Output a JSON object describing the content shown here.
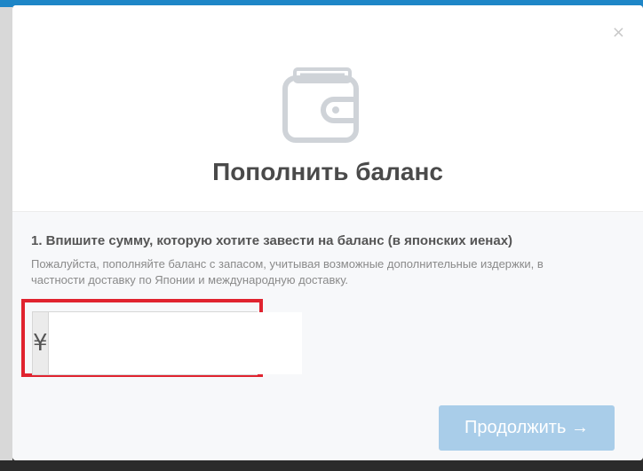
{
  "modal": {
    "close_label": "×",
    "title": "Пополнить баланс",
    "step_label": "1. Впишите сумму, которую хотите завести на баланс (в японских иенах)",
    "hint": "Пожалуйста, пополняйте баланс с запасом, учитывая возможные дополнительные издержки, в частности доставку по Японии и международную доставку.",
    "currency_symbol": "¥",
    "amount_value": "",
    "continue_label": "Продолжить →"
  },
  "colors": {
    "accent": "#a9cde9",
    "highlight": "#e0232f",
    "icon": "#cfd3d8"
  },
  "icons": {
    "wallet": "wallet-icon",
    "close": "close-icon"
  }
}
